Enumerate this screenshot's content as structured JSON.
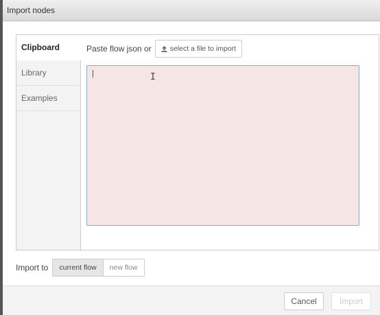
{
  "dialog": {
    "title": "Import nodes"
  },
  "tabs": [
    {
      "label": "Clipboard",
      "active": true
    },
    {
      "label": "Library",
      "active": false
    },
    {
      "label": "Examples",
      "active": false
    }
  ],
  "clipboard": {
    "paste_label": "Paste flow json or",
    "file_button_label": "select a file to import",
    "file_button_icon": "upload-icon",
    "json_value": ""
  },
  "import_to": {
    "label": "Import to",
    "options": [
      {
        "label": "current flow",
        "selected": true
      },
      {
        "label": "new flow",
        "selected": false
      }
    ]
  },
  "footer": {
    "cancel_label": "Cancel",
    "import_label": "Import",
    "import_disabled": true
  },
  "colors": {
    "textarea_background": "#f6e5e5",
    "textarea_border": "#8aa6d6"
  }
}
